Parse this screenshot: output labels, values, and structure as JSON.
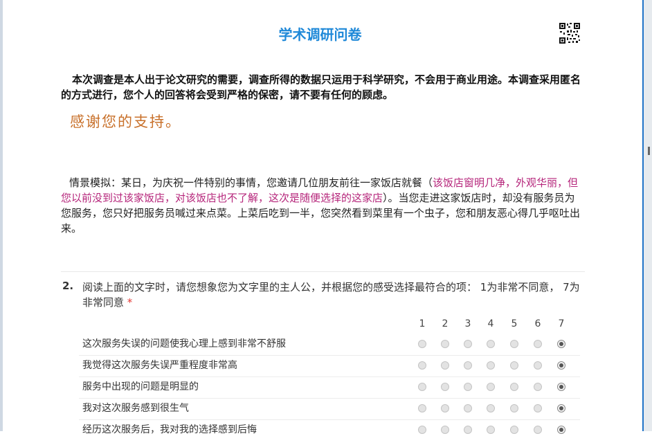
{
  "survey": {
    "title": "学术调研问卷",
    "intro": "本次调查是本人出于论文研究的需要，调查所得的数据只运用于科学研究，不会用于商业用途。本调查采用匿名的方式进行，您个人的回答将会受到严格的保密，请不要有任何的顾虑。",
    "thanks": "感谢您的支持。",
    "scenario": {
      "part1": "情景模拟：某日，为庆祝一件特别的事情，您邀请几位朋友前往一家饭店就餐（",
      "highlight": "该饭店窗明几净，外观华丽，但您以前没到过该家饭店，对该饭店也不了解，这次是随便选择的这家店",
      "part2": "）。当您走进这家饭店时，却没有服务员为您服务，您只好把服务员喊过来点菜。上菜后吃到一半，您突然看到菜里有一个虫子，您和朋友恶心得几乎呕吐出来。"
    }
  },
  "question": {
    "number": "2.",
    "text": "阅读上面的文字时，请您想象您为文字里的主人公，并根据您的感受选择最符合的项：  1为非常不同意， 7为非常同意",
    "required_mark": "*",
    "scale": [
      "1",
      "2",
      "3",
      "4",
      "5",
      "6",
      "7"
    ],
    "rows": [
      {
        "label": "这次服务失误的问题使我心理上感到非常不舒服",
        "selected": 7
      },
      {
        "label": "我觉得这次服务失误严重程度非常高",
        "selected": 7
      },
      {
        "label": "服务中出现的问题是明显的",
        "selected": 7
      },
      {
        "label": "我对这次服务感到很生气",
        "selected": 7
      },
      {
        "label": "经历这次服务后，我对我的选择感到后悔",
        "selected": 7
      }
    ]
  },
  "colors": {
    "title": "#1e88d8",
    "thanks": "#c8702a",
    "highlight": "#b5247a",
    "required": "#e53935"
  }
}
